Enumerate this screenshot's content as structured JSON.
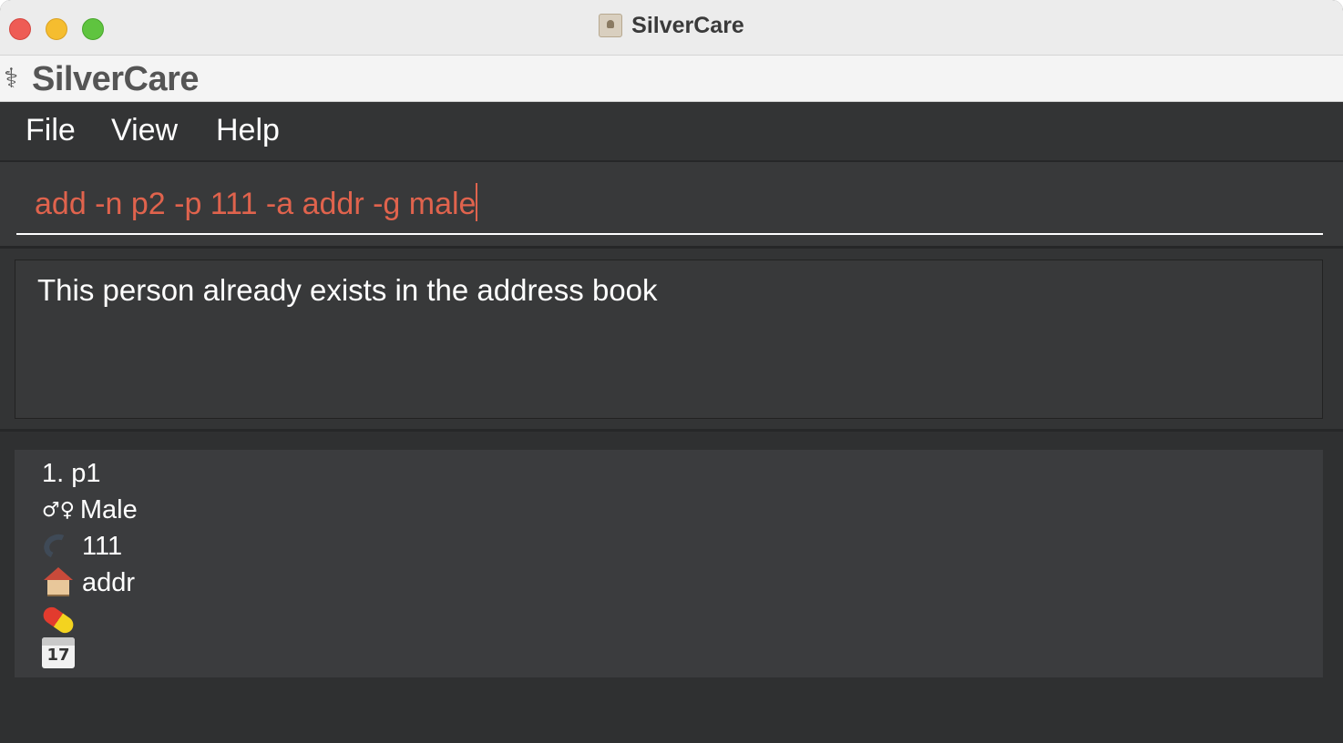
{
  "window": {
    "title": "SilverCare"
  },
  "app": {
    "name": "SilverCare"
  },
  "menu": {
    "items": [
      "File",
      "View",
      "Help"
    ]
  },
  "command": {
    "value": "add -n p2 -p 111 -a addr -g male"
  },
  "result": {
    "message": "This person already exists in the address book"
  },
  "persons": [
    {
      "index_name": "1. p1",
      "gender_symbol": "♂♀",
      "gender": "Male",
      "phone": "111",
      "address": "addr",
      "medication": "",
      "appointment": "",
      "calendar_day": "17"
    }
  ]
}
